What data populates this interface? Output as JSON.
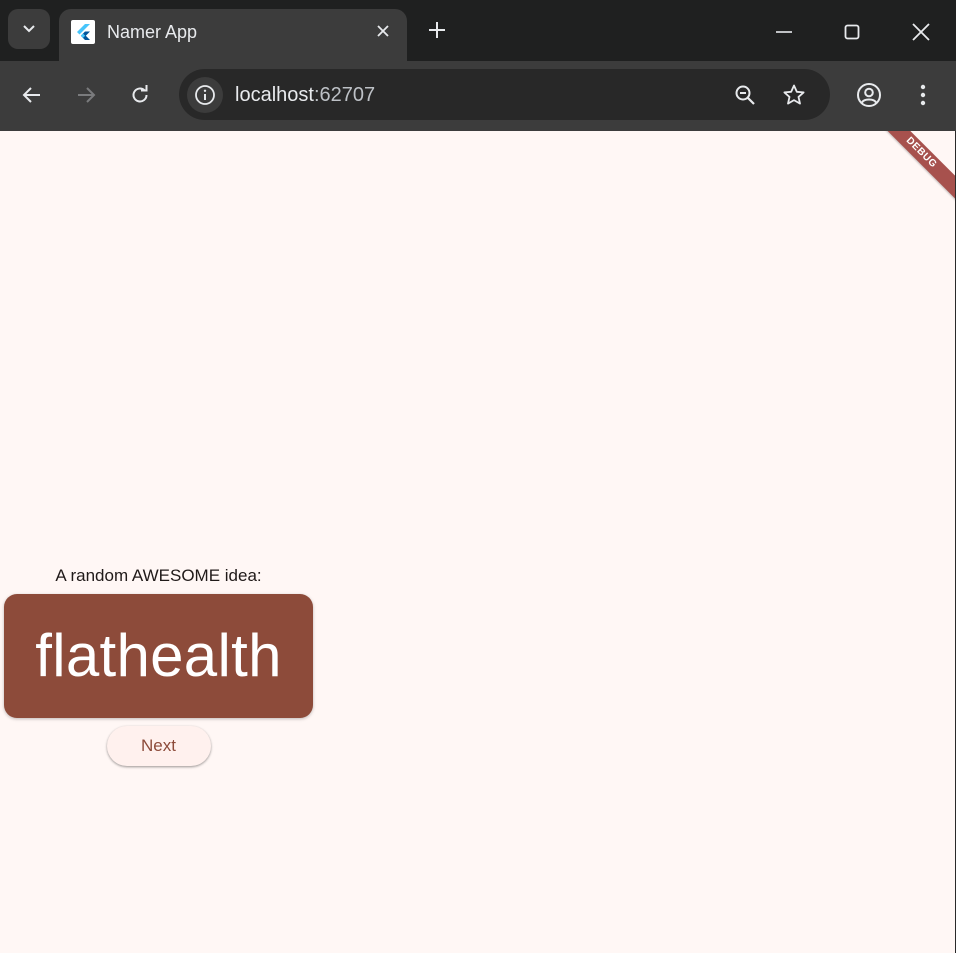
{
  "browser": {
    "tab": {
      "title": "Namer App"
    },
    "address_bar": {
      "host": "localhost",
      "port": ":62707"
    },
    "icons": [
      "chevron-down-icon",
      "flutter-icon",
      "close-icon",
      "plus-icon",
      "minimize-icon",
      "maximize-icon",
      "window-close-icon",
      "back-arrow-icon",
      "forward-arrow-icon",
      "reload-icon",
      "info-icon",
      "zoom-out-icon",
      "star-icon",
      "profile-icon",
      "more-vert-icon"
    ]
  },
  "page": {
    "debug_banner": "DEBUG",
    "label": "A random AWESOME idea:",
    "word": "flathealth",
    "next_button": "Next"
  },
  "colors": {
    "page_background": "#fff7f5",
    "card_background": "#8d4b3a",
    "card_text": "#ffffff",
    "button_background": "#fff1ee",
    "button_text": "#8d4b3a",
    "debug_banner": "#a7514d"
  }
}
